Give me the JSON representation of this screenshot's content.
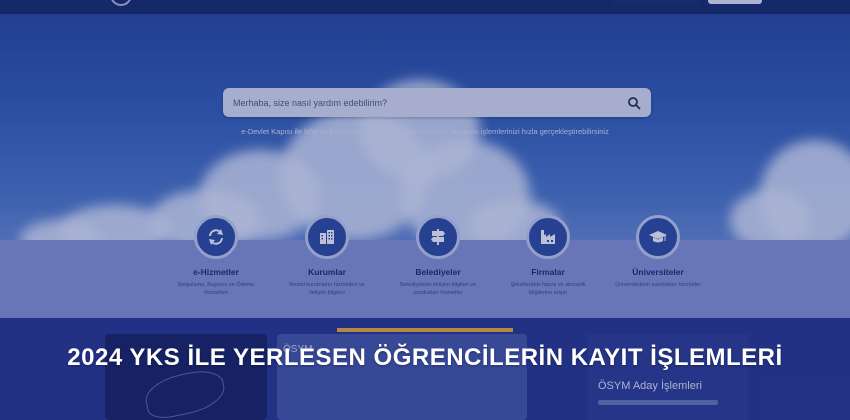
{
  "search": {
    "placeholder": "Merhaba, size nasıl yardım edebilirim?"
  },
  "tagline": "e-Devlet Kapısı ile bilgi ve belgelerinize tek noktadan ulaşabilir, başvuru işlemlerinizi hızla gerçekleştirebilirsiniz",
  "services": [
    {
      "title": "e-Hizmetler",
      "desc": "Sorgulama, Başvuru ve Ödeme hizmetleri",
      "icon": "refresh-arrows-icon"
    },
    {
      "title": "Kurumlar",
      "desc": "Resmi kurumların hizmetleri ve iletişim bilgileri",
      "icon": "buildings-icon"
    },
    {
      "title": "Belediyeler",
      "desc": "Belediyelerin iletişim bilgileri ve sundukları hizmetler",
      "icon": "signpost-icon"
    },
    {
      "title": "Firmalar",
      "desc": "Şirketlerdeki fatura ve abonelik bilgilerine erişin",
      "icon": "factory-icon"
    },
    {
      "title": "Üniversiteler",
      "desc": "Üniversitelerin sundukları hizmetler",
      "icon": "graduation-cap-icon"
    }
  ],
  "cards": {
    "mid_label": "ÖSYM",
    "right_label": "ÖSYM Aday İşlemleri"
  },
  "headline": "2024 YKS İLE YERLESEN ÖĞRENCİLERİN KAYIT İŞLEMLERİ",
  "colors": {
    "accent": "#f1b233",
    "icon_circle": "#2f4ea0",
    "service_band": "#8a98d2"
  }
}
